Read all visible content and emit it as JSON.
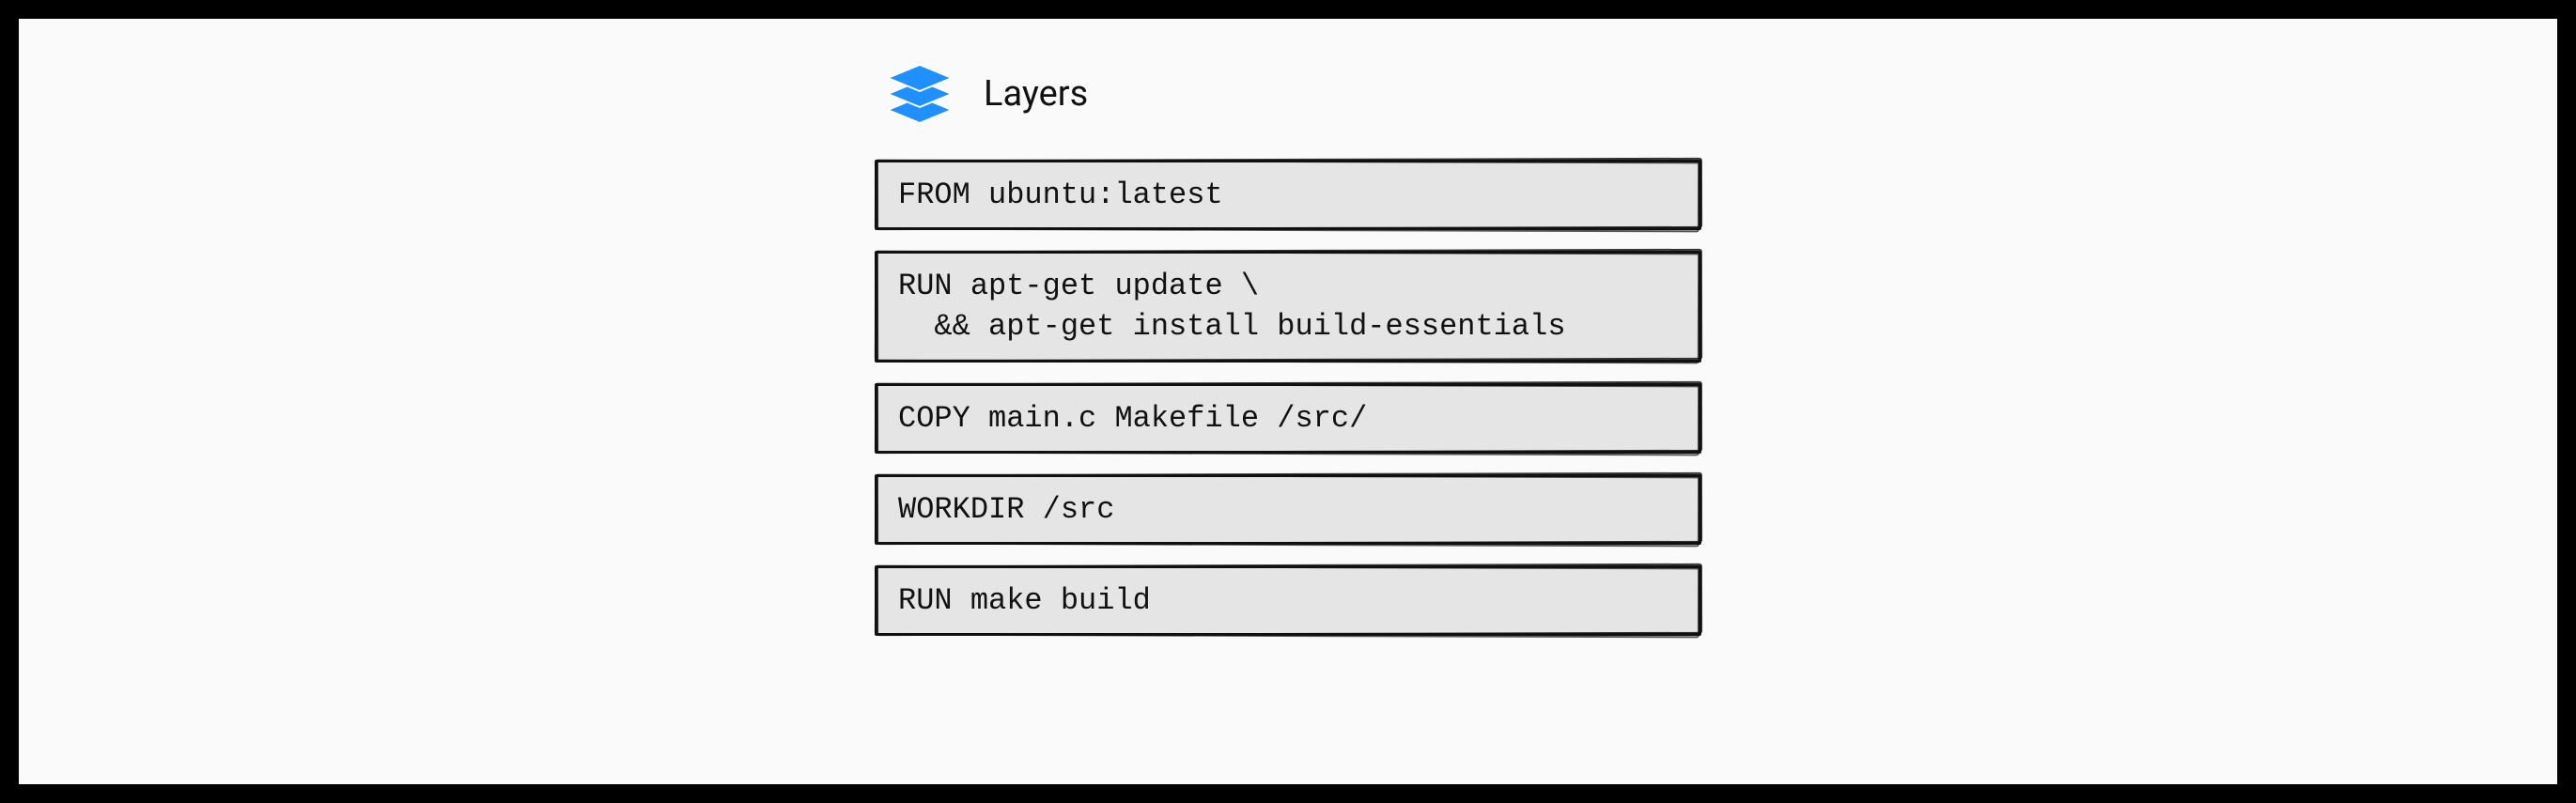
{
  "header": {
    "icon": "layers-icon",
    "label": "Layers"
  },
  "layers": [
    "FROM ubuntu:latest",
    "RUN apt-get update \\\n  && apt-get install build-essentials",
    "COPY main.c Makefile /src/",
    "WORKDIR /src",
    "RUN make build"
  ],
  "colors": {
    "accent": "#1e90ff",
    "layer_bg": "#e5e5e5",
    "border": "#111111",
    "canvas": "#fafafa"
  }
}
